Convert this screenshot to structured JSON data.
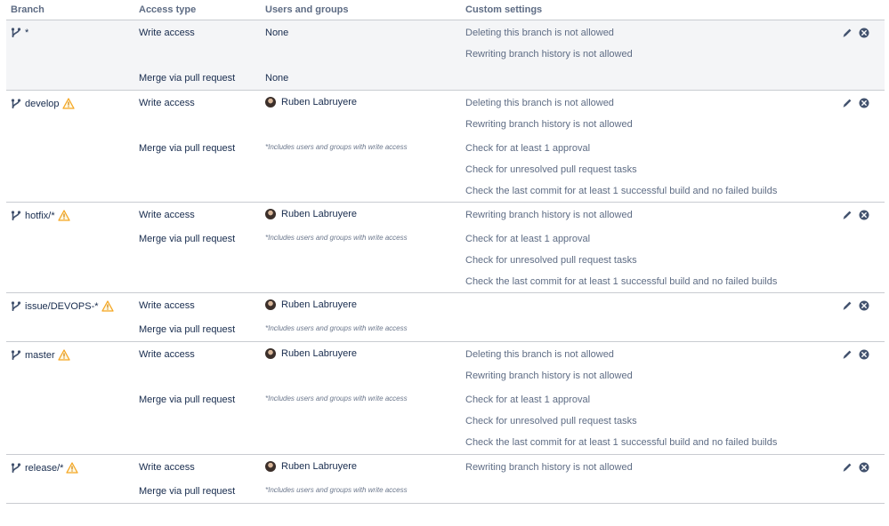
{
  "header": {
    "branch": "Branch",
    "access_type": "Access type",
    "users_groups": "Users and groups",
    "custom_settings": "Custom settings"
  },
  "colors": {
    "warning": "#f5a623",
    "row_highlight": "#f4f5f7",
    "icon": "#42526e"
  },
  "rows": [
    {
      "branch": "*",
      "warning": false,
      "write_label": "Write access",
      "write_users": "None",
      "merge_label": "Merge via pull request",
      "merge_users": "None",
      "settings": [
        "Deleting this branch is not allowed",
        "Rewriting branch history is not allowed"
      ]
    },
    {
      "branch": "develop",
      "warning": true,
      "write_label": "Write access",
      "write_user": "Ruben Labruyere",
      "merge_label": "Merge via pull request",
      "merge_note": "*Includes users and groups with write access",
      "settings": [
        "Deleting this branch is not allowed",
        "Rewriting branch history is not allowed",
        "Check for at least 1 approval",
        "Check for unresolved pull request tasks",
        "Check the last commit for at least 1 successful build and no failed builds"
      ]
    },
    {
      "branch": "hotfix/*",
      "warning": true,
      "write_label": "Write access",
      "write_user": "Ruben Labruyere",
      "merge_label": "Merge via pull request",
      "merge_note": "*Includes users and groups with write access",
      "settings": [
        "Rewriting branch history is not allowed",
        "Check for at least 1 approval",
        "Check for unresolved pull request tasks",
        "Check the last commit for at least 1 successful build and no failed builds"
      ]
    },
    {
      "branch": "issue/DEVOPS-*",
      "warning": true,
      "write_label": "Write access",
      "write_user": "Ruben Labruyere",
      "merge_label": "Merge via pull request",
      "merge_note": "*Includes users and groups with write access",
      "settings": []
    },
    {
      "branch": "master",
      "warning": true,
      "write_label": "Write access",
      "write_user": "Ruben Labruyere",
      "merge_label": "Merge via pull request",
      "merge_note": "*Includes users and groups with write access",
      "settings": [
        "Deleting this branch is not allowed",
        "Rewriting branch history is not allowed",
        "Check for at least 1 approval",
        "Check for unresolved pull request tasks",
        "Check the last commit for at least 1 successful build and no failed builds"
      ]
    },
    {
      "branch": "release/*",
      "warning": true,
      "write_label": "Write access",
      "write_user": "Ruben Labruyere",
      "merge_label": "Merge via pull request",
      "merge_note": "*Includes users and groups with write access",
      "settings": [
        "Rewriting branch history is not allowed"
      ]
    }
  ]
}
